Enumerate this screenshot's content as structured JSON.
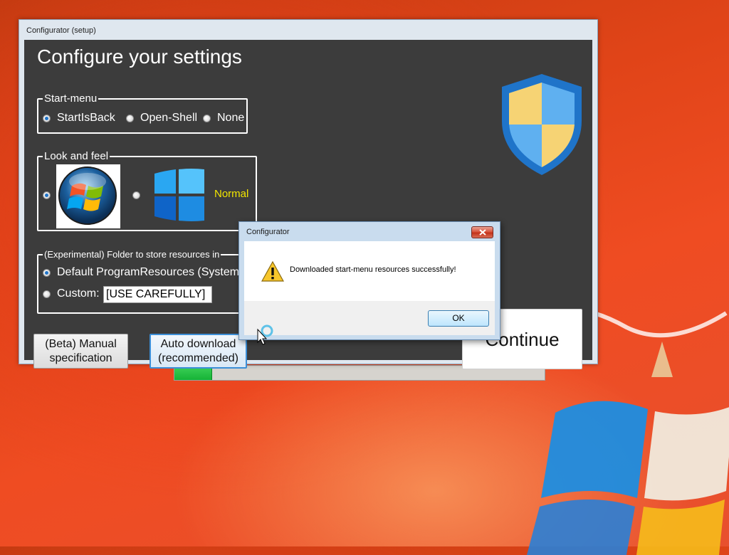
{
  "main_window": {
    "title": "Configurator (setup)",
    "heading": "Configure your settings",
    "start_menu": {
      "legend": "Start-menu",
      "options": [
        "StartIsBack",
        "Open-Shell",
        "None"
      ],
      "selected": "StartIsBack"
    },
    "look_and_feel": {
      "legend": "Look and feel",
      "option2_label": "Normal",
      "label_color": "#f2e600"
    },
    "resources_folder": {
      "legend": "(Experimental) Folder to store resources in",
      "default_option": "Default ProgramResources (SystemD",
      "custom_label": "Custom:",
      "custom_value": "[USE CAREFULLY]"
    },
    "buttons": {
      "manual": [
        "(Beta) Manual",
        "specification"
      ],
      "auto": [
        "Auto download",
        "(recommended)"
      ],
      "continue": "Continue"
    },
    "progress": 0.1
  },
  "dialog": {
    "title": "Configurator",
    "message": "Downloaded start-menu resources successfully!",
    "ok_label": "OK",
    "icon": "warning-icon"
  },
  "colors": {
    "client_bg": "#3c3c3c",
    "accent_blue": "#1f74c9",
    "progress_green": "#16b336"
  }
}
